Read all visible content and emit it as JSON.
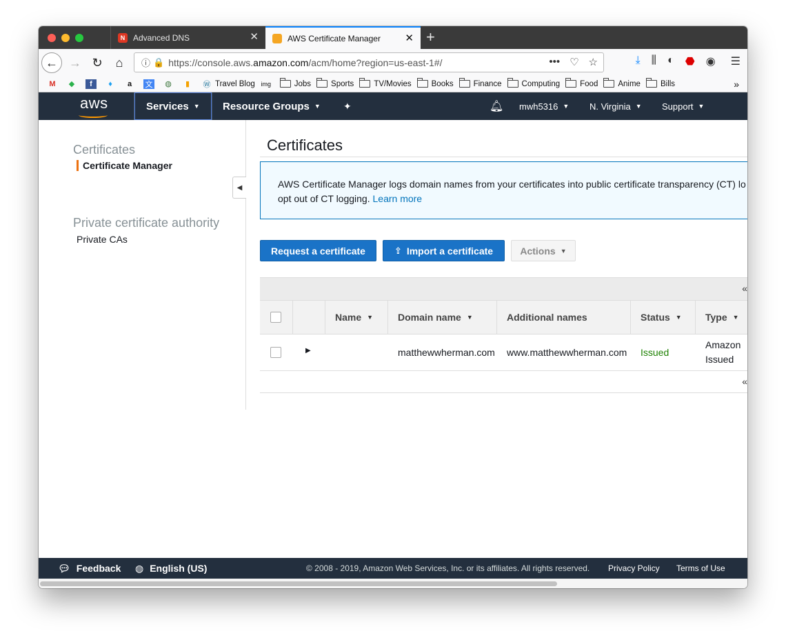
{
  "browser": {
    "tabs": [
      {
        "title": "Advanced DNS",
        "active": false
      },
      {
        "title": "AWS Certificate Manager",
        "active": true
      }
    ],
    "url": {
      "prefix": "https://console.aws.",
      "host": "amazon.com",
      "path": "/acm/home?region=us-east-1#/"
    },
    "bookmarks": [
      "Travel Blog",
      "Jobs",
      "Sports",
      "TV/Movies",
      "Books",
      "Finance",
      "Computing",
      "Food",
      "Anime",
      "Bills"
    ]
  },
  "aws_header": {
    "logo": "aws",
    "services": "Services",
    "resource_groups": "Resource Groups",
    "user": "mwh5316",
    "region": "N. Virginia",
    "support": "Support"
  },
  "sidebar": {
    "section1": "Certificates",
    "item1": "Certificate Manager",
    "section2": "Private certificate authority",
    "item2": "Private CAs"
  },
  "main": {
    "title": "Certificates",
    "info_text": "AWS Certificate Manager logs domain names from your certificates into public certificate transparency (CT) lo",
    "info_text2": "opt out of CT logging. ",
    "learn_more": "Learn more",
    "request_btn": "Request a certificate",
    "import_btn": "Import a certificate",
    "actions_btn": "Actions"
  },
  "table": {
    "headers": {
      "name": "Name",
      "domain": "Domain name",
      "additional": "Additional names",
      "status": "Status",
      "type": "Type"
    },
    "rows": [
      {
        "name": "",
        "domain": "matthewwherman.com",
        "additional": "www.matthewwherman.com",
        "status": "Issued",
        "type_line1": "Amazon",
        "type_line2": "Issued"
      }
    ]
  },
  "footer": {
    "feedback": "Feedback",
    "language": "English (US)",
    "copyright": "© 2008 - 2019, Amazon Web Services, Inc. or its affiliates. All rights reserved.",
    "privacy": "Privacy Policy",
    "terms": "Terms of Use"
  },
  "colors": {
    "aws_nav": "#232f3e",
    "aws_orange": "#ff9900",
    "primary_button": "#1a73c7",
    "status_issued": "#1d8102"
  }
}
